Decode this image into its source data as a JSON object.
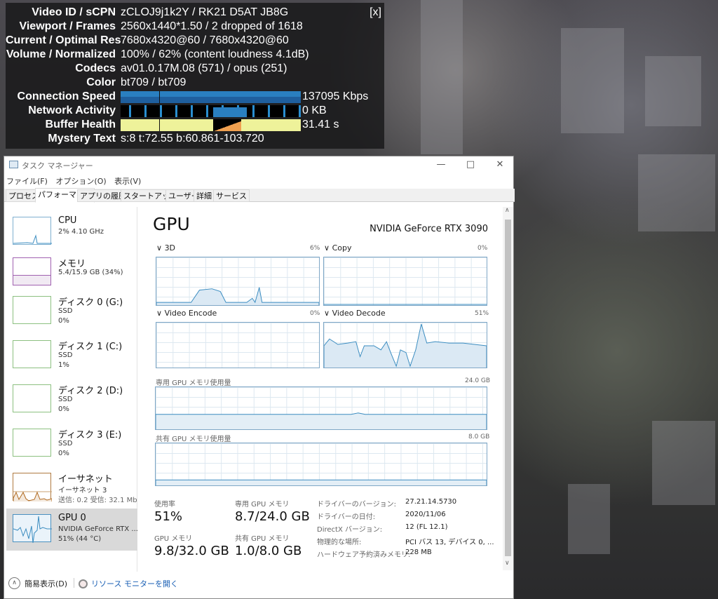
{
  "stats": {
    "rows": [
      {
        "k": "Video ID / sCPN",
        "v": "zCLOJ9j1k2Y / RK21 D5AT JB8G"
      },
      {
        "k": "Viewport / Frames",
        "v": "2560x1440*1.50 / 2 dropped of 1618"
      },
      {
        "k": "Current / Optimal Res",
        "v": "7680x4320@60 / 7680x4320@60"
      },
      {
        "k": "Volume / Normalized",
        "v": "100% / 62% (content loudness 4.1dB)"
      },
      {
        "k": "Codecs",
        "v": "av01.0.17M.08 (571) / opus (251)"
      },
      {
        "k": "Color",
        "v": "bt709 / bt709"
      },
      {
        "k": "Connection Speed",
        "v": "137095 Kbps"
      },
      {
        "k": "Network Activity",
        "v": "0 KB"
      },
      {
        "k": "Buffer Health",
        "v": "31.41 s"
      },
      {
        "k": "Mystery Text",
        "v": "s:8 t:72.55 b:60.861-103.720"
      }
    ],
    "close": "[x]"
  },
  "tm": {
    "title": "タスク マネージャー",
    "menu": [
      "ファイル(F)",
      "オプション(O)",
      "表示(V)"
    ],
    "tabs": [
      "プロセス",
      "パフォーマンス",
      "アプリの履歴",
      "スタートアップ",
      "ユーザー",
      "詳細",
      "サービス"
    ],
    "side": [
      {
        "t1": "CPU",
        "t2": "2%  4.10 GHz",
        "t3": ""
      },
      {
        "t1": "メモリ",
        "t2": "5.4/15.9 GB (34%)",
        "t3": ""
      },
      {
        "t1": "ディスク 0 (G:)",
        "t2": "SSD",
        "t3": "0%"
      },
      {
        "t1": "ディスク 1 (C:)",
        "t2": "SSD",
        "t3": "1%"
      },
      {
        "t1": "ディスク 2 (D:)",
        "t2": "SSD",
        "t3": "0%"
      },
      {
        "t1": "ディスク 3 (E:)",
        "t2": "SSD",
        "t3": "0%"
      },
      {
        "t1": "イーサネット",
        "t2": "イーサネット 3",
        "t3": "送信: 0.2  受信: 32.1 Mb"
      },
      {
        "t1": "GPU 0",
        "t2": "NVIDIA GeForce RTX ...",
        "t3": "51% (44 °C)"
      }
    ],
    "gpu": {
      "title": "GPU",
      "name": "NVIDIA GeForce RTX 3090",
      "engines": [
        {
          "l": "3D",
          "v": "6%"
        },
        {
          "l": "Copy",
          "v": "0%"
        },
        {
          "l": "Video Encode",
          "v": "0%"
        },
        {
          "l": "Video Decode",
          "v": "51%"
        }
      ],
      "ded_label": "専用 GPU メモリ使用量",
      "ded_max": "24.0 GB",
      "sh_label": "共有 GPU メモリ使用量",
      "sh_max": "8.0 GB",
      "util_l": "使用率",
      "util_v": "51%",
      "dmem_l": "専用 GPU メモリ",
      "dmem_v": "8.7/24.0 GB",
      "gmem_l": "GPU メモリ",
      "gmem_v": "9.8/32.0 GB",
      "smem_l": "共有 GPU メモリ",
      "smem_v": "1.0/8.0 GB",
      "info": [
        {
          "k": "ドライバーのバージョン:",
          "v": "27.21.14.5730"
        },
        {
          "k": "ドライバーの日付:",
          "v": "2020/11/06"
        },
        {
          "k": "DirectX バージョン:",
          "v": "12 (FL 12.1)"
        },
        {
          "k": "物理的な場所:",
          "v": "PCI バス 13, デバイス 0, ..."
        },
        {
          "k": "ハードウェア予約済みメモリ:",
          "v": "228 MB"
        }
      ]
    },
    "footer": {
      "fewer": "簡易表示(D)",
      "resmon": "リソース モニターを開く"
    }
  }
}
